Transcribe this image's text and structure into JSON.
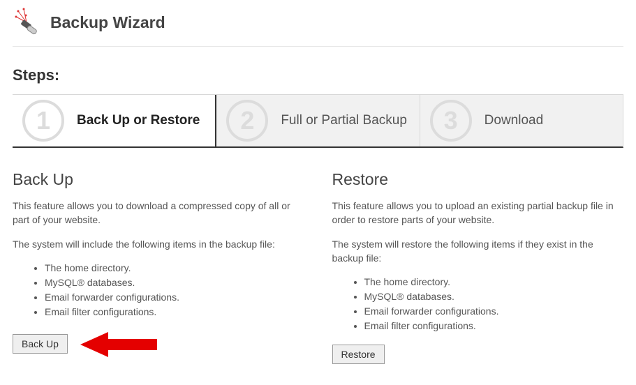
{
  "header": {
    "title": "Backup Wizard"
  },
  "steps_label": "Steps:",
  "steps": [
    {
      "num": "1",
      "label": "Back Up or Restore",
      "active": true
    },
    {
      "num": "2",
      "label": "Full or Partial Backup",
      "active": false
    },
    {
      "num": "3",
      "label": "Download",
      "active": false
    }
  ],
  "backup": {
    "heading": "Back Up",
    "intro": "This feature allows you to download a compressed copy of all or part of your website.",
    "list_intro": "The system will include the following items in the backup file:",
    "items": [
      "The home directory.",
      "MySQL® databases.",
      "Email forwarder configurations.",
      "Email filter configurations."
    ],
    "button": "Back Up"
  },
  "restore": {
    "heading": "Restore",
    "intro": "This feature allows you to upload an existing partial backup file in order to restore parts of your website.",
    "list_intro": "The system will restore the following items if they exist in the backup file:",
    "items": [
      "The home directory.",
      "MySQL® databases.",
      "Email forwarder configurations.",
      "Email filter configurations."
    ],
    "button": "Restore"
  }
}
